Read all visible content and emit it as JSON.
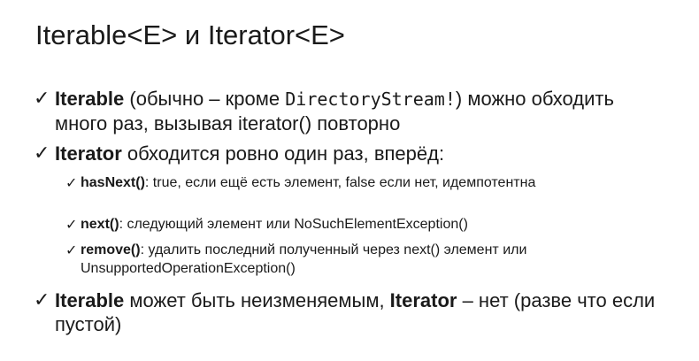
{
  "title": "Iterable<E> и Iterator<E>",
  "bullets": {
    "b1": {
      "check": "✓",
      "bold": "Iterable",
      "pre": " (обычно – кроме ",
      "code": "DirectoryStream!",
      "post": ") можно обходить много раз, вызывая iterator() повторно"
    },
    "b2": {
      "check": "✓",
      "bold": "Iterator",
      "text": " обходится ровно один раз, вперёд:"
    },
    "s1": {
      "check": "✓",
      "bold": "hasNext()",
      "text": ": true, если ещё есть элемент, false если нет, идемпотентна"
    },
    "s2": {
      "check": "✓",
      "bold": "next()",
      "text": ": следующий элемент или NoSuchElementException()"
    },
    "s3": {
      "check": "✓",
      "bold": "remove()",
      "text": ": удалить последний полученный через next() элемент или UnsupportedOperationException()"
    },
    "b3": {
      "check": "✓",
      "bold1": "Iterable",
      "mid": " может быть неизменяемым, ",
      "bold2": "Iterator",
      "post": " – нет (разве что если пустой)"
    }
  }
}
